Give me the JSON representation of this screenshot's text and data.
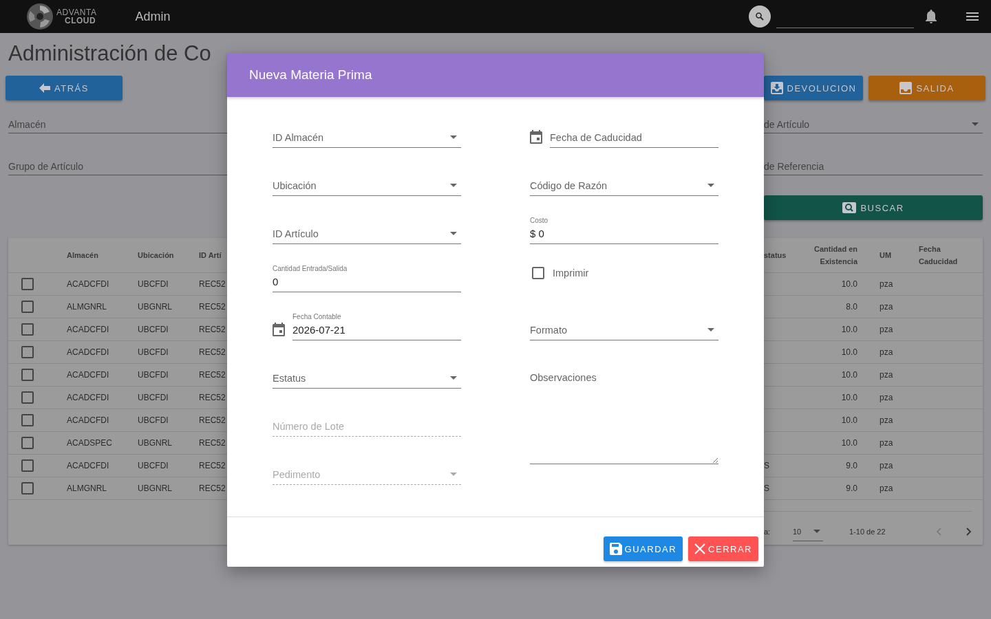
{
  "app_bar": {
    "logo_lines": [
      "ADVANTA",
      "CLOUD"
    ],
    "title": "Admin"
  },
  "page": {
    "title": "Administración de Co",
    "back_button": "ATRÁS",
    "action_buttons": [
      {
        "label": "DEVOLUCION",
        "kind": "return"
      },
      {
        "label": "SALIDA",
        "kind": "exit"
      }
    ],
    "filters_left": [
      {
        "label": "Almacén",
        "kind": "text"
      },
      {
        "label": "Grupo de Artículo",
        "kind": "text"
      }
    ],
    "filters_right": [
      {
        "label": "de Artículo",
        "kind": "select"
      },
      {
        "label": "de Referencia",
        "kind": "text"
      }
    ],
    "search_button": "BUSCAR"
  },
  "table": {
    "columns_left": [
      "Almacén",
      "Ubicación",
      "ID Artí"
    ],
    "columns_right": [
      "status",
      "Cantidad en Existencia",
      "UM",
      "Fecha Caducidad"
    ],
    "rows": [
      {
        "checked": false,
        "almacen": "ACADCFDI",
        "ubicacion": "UBCFDI",
        "id_articulo": "REC52",
        "cantidad": "10.0",
        "um": "pza"
      },
      {
        "checked": false,
        "almacen": "ALMGNRL",
        "ubicacion": "UBGNRL",
        "id_articulo": "REC52",
        "cantidad": "8.0",
        "um": "pza"
      },
      {
        "checked": false,
        "almacen": "ACADCFDI",
        "ubicacion": "UBCFDI",
        "id_articulo": "REC52",
        "cantidad": "10.0",
        "um": "pza"
      },
      {
        "checked": false,
        "almacen": "ACADCFDI",
        "ubicacion": "UBCFDI",
        "id_articulo": "REC52",
        "cantidad": "10.0",
        "um": "pza"
      },
      {
        "checked": false,
        "almacen": "ACADCFDI",
        "ubicacion": "UBCFDI",
        "id_articulo": "REC52",
        "cantidad": "10.0",
        "um": "pza"
      },
      {
        "checked": false,
        "almacen": "ACADCFDI",
        "ubicacion": "UBCFDI",
        "id_articulo": "REC52",
        "cantidad": "10.0",
        "um": "pza"
      },
      {
        "checked": false,
        "almacen": "ACADCFDI",
        "ubicacion": "UBCFDI",
        "id_articulo": "REC52",
        "cantidad": "10.0",
        "um": "pza"
      },
      {
        "checked": false,
        "almacen": "ACADSPEC",
        "ubicacion": "UBGNRL",
        "id_articulo": "REC52",
        "cantidad": "10.0",
        "um": "pza"
      },
      {
        "checked": false,
        "almacen": "ACADCFDI",
        "ubicacion": "UBCFDI",
        "id_articulo": "REC52",
        "status": "S",
        "cantidad": "9.0",
        "um": "pza"
      },
      {
        "checked": false,
        "almacen": "ALMGNRL",
        "ubicacion": "UBGNRL",
        "id_articulo": "REC52",
        "status": "S",
        "cantidad": "9.0",
        "um": "pza"
      }
    ],
    "pagination": {
      "rows_label": "a:",
      "rows_per_page": "10",
      "range": "1-10 de 22"
    }
  },
  "modal": {
    "title": "Nueva Materia Prima",
    "left_fields": [
      {
        "kind": "select",
        "label": "ID Almacén",
        "disabled": false
      },
      {
        "kind": "select",
        "label": "Ubicación",
        "disabled": false
      },
      {
        "kind": "select",
        "label": "ID Artículo",
        "disabled": false
      },
      {
        "kind": "text",
        "label": "Cantidad Entrada/Salida",
        "value": "0",
        "disabled": false
      },
      {
        "kind": "date",
        "label": "Fecha Contable",
        "value": "2026-07-21",
        "disabled": false
      },
      {
        "kind": "select",
        "label": "Estatus",
        "disabled": false
      },
      {
        "kind": "text",
        "label": "Número de Lote",
        "disabled": true
      },
      {
        "kind": "select",
        "label": "Pedimento",
        "disabled": true
      }
    ],
    "right_fields": [
      {
        "kind": "date",
        "label": "Fecha de Caducidad"
      },
      {
        "kind": "select",
        "label": "Código de Razón"
      },
      {
        "kind": "text",
        "label": "Costo",
        "value": "$ 0"
      },
      {
        "kind": "checkbox",
        "label": "Imprimir",
        "checked": false
      },
      {
        "kind": "select",
        "label": "Formato"
      },
      {
        "kind": "textarea",
        "label": "Observaciones"
      }
    ],
    "buttons": [
      {
        "label": "GUARDAR",
        "kind": "save"
      },
      {
        "label": "CERRAR",
        "kind": "close"
      }
    ]
  }
}
